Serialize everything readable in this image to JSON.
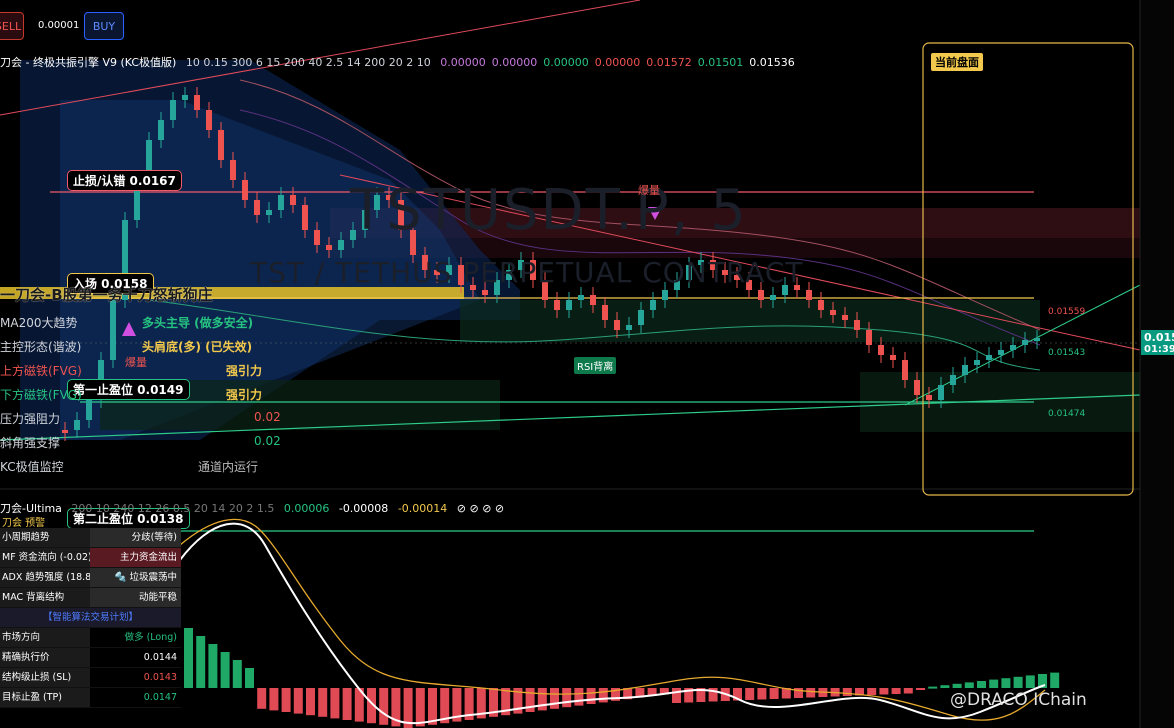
{
  "colors": {
    "bull": "#26a69a",
    "bear": "#ef5350",
    "accent": "#f2c94c",
    "magenta": "#d14fe0"
  },
  "buttons": {
    "sell": "SELL",
    "spread": "0.00001",
    "buy": "BUY"
  },
  "legend": {
    "title": "刀会 - 终极共振引擎 V9 (KC极值版)",
    "params": "10 0.15 300 6 15 200 40 2.5 14 200 20 2 10",
    "values": [
      {
        "v": "0.00000",
        "c": "#c678dd"
      },
      {
        "v": "0.00000",
        "c": "#c678dd"
      },
      {
        "v": "0.00000",
        "c": "#26c281"
      },
      {
        "v": "0.00000",
        "c": "#ef5350"
      },
      {
        "v": "0.01572",
        "c": "#ef5350"
      },
      {
        "v": "0.01501",
        "c": "#26c281"
      },
      {
        "v": "0.01536",
        "c": "#ffffff"
      }
    ]
  },
  "legend2": {
    "title": "刀会-Ultima",
    "params": "200 10 240 12 26 0.5 20 14 20 2 1.5",
    "v1": "0.00006",
    "v2": "-0.00008",
    "v3": "-0.00014",
    "symbols": "⊘ ⊘ ⊘ ⊘",
    "sub": "刀会 预警"
  },
  "watermark": {
    "symbol": "TSTUSDT.P, 5",
    "desc": "TST / TETHUS PERPETUAL CONTRACT"
  },
  "levels": {
    "stop": "止损/认错 0.0167",
    "entry": "入场 0.0158",
    "tp1": "第一止盈位 0.0149",
    "tp2": "第二止盈位 0.0138"
  },
  "banner": "一刀会-B股第一务千刀怒斩狗庄",
  "current_box": "当前盘面",
  "signals": {
    "explode": "爆量",
    "rsi": "RSI背离",
    "explode2": "爆量"
  },
  "panel": [
    {
      "label": "MA200大趋势",
      "value": "多头主导 (做多安全)",
      "color": "#26c281"
    },
    {
      "label": "主控形态(谐波)",
      "value": "头肩底(多) (已失效)",
      "color": "#f2c94c"
    },
    {
      "label": "上方磁铁(FVG)",
      "value": "强引力",
      "color": "#f2c94c",
      "labelColor": "#ef5350"
    },
    {
      "label": "下方磁铁(FVG)",
      "value": "强引力",
      "color": "#f2c94c",
      "labelColor": "#26c281"
    },
    {
      "label": "压力强阻力",
      "value": "0.02",
      "color": "#ef5350"
    },
    {
      "label": "斜角强支撑",
      "value": "0.02",
      "color": "#26c281"
    },
    {
      "label": "KC极值监控",
      "value": "通道内运行",
      "color": "#bbbbbb"
    }
  ],
  "plan": {
    "rows_top": [
      {
        "k": "小周期趋势",
        "v": "分歧(等待)",
        "bg": "#2a2a2a",
        "c": "#ffffff"
      },
      {
        "k": "MF 资金流向 (-0.02)",
        "v": "主力资金流出",
        "bg": "#5a1a22",
        "c": "#ffffff"
      },
      {
        "k": "ADX 趋势强度 (18.8)",
        "v": "🔩 垃圾震荡中",
        "bg": "#2a2a2a",
        "c": "#ffffff"
      },
      {
        "k": "MAC 背离结构",
        "v": "动能平稳",
        "bg": "#2a2a2a",
        "c": "#ffffff"
      }
    ],
    "header": "【智能算法交易计划】",
    "rows_bottom": [
      {
        "k": "市场方向",
        "v": "做多 (Long)",
        "bg": "#000",
        "c": "#26c281"
      },
      {
        "k": "精确执行价",
        "v": "0.0144",
        "bg": "#000",
        "c": "#ffffff"
      },
      {
        "k": "结构级止损 (SL)",
        "v": "0.0143",
        "bg": "#000",
        "c": "#ef5350"
      },
      {
        "k": "目标止盈 (TP)",
        "v": "0.0147",
        "bg": "#000",
        "c": "#26c281"
      }
    ]
  },
  "price_axis": {
    "current": "0.015",
    "time": "01:39"
  },
  "right_labels": {
    "a": "0.01559",
    "b": "0.01543",
    "c": "0.01474"
  },
  "footer_brand": "@DRACO IChain"
}
